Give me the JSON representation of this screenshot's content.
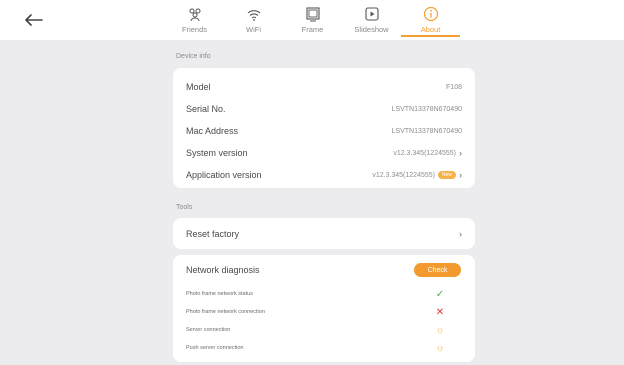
{
  "nav": {
    "back_icon": "arrow-left-icon",
    "tabs": [
      {
        "label": "Friends",
        "icon": "friends-icon",
        "active": false
      },
      {
        "label": "WiFi",
        "icon": "wifi-icon",
        "active": false
      },
      {
        "label": "Frame",
        "icon": "frame-icon",
        "active": false
      },
      {
        "label": "Slideshow",
        "icon": "slideshow-icon",
        "active": false
      },
      {
        "label": "About",
        "icon": "info-icon",
        "active": true
      }
    ]
  },
  "device_info": {
    "title": "Device info",
    "rows": [
      {
        "label": "Model",
        "value": "F108"
      },
      {
        "label": "Serial No.",
        "value": "LSVTN13378N670490"
      },
      {
        "label": "Mac Address",
        "value": "LSVTN13378N670490"
      },
      {
        "label": "System version",
        "value": "v12.3.345(1224555)"
      },
      {
        "label": "Application version",
        "value": "v12.3.345(1224555)",
        "badge": "New"
      }
    ]
  },
  "tools": {
    "title": "Tools",
    "reset_label": "Reset factory"
  },
  "network": {
    "title": "Network diagnosis",
    "check_label": "Check",
    "items": [
      {
        "label": "Photo frame network status",
        "status": "ok"
      },
      {
        "label": "Photo frame network connection",
        "status": "fail"
      },
      {
        "label": "Server connection",
        "status": "pending"
      },
      {
        "label": "Push server connection",
        "status": "pending"
      }
    ]
  },
  "colors": {
    "accent": "#f6a033",
    "ok": "#4caf50",
    "fail": "#e53935"
  }
}
